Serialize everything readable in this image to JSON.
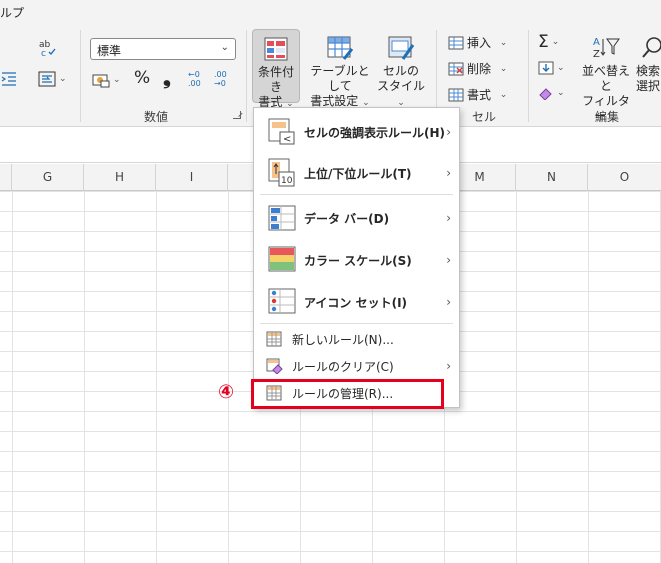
{
  "menubar": {
    "help_tab": "ルプ"
  },
  "ribbon": {
    "number_group": {
      "format_value": "標準",
      "label": "数値",
      "percent_label": "%",
      "comma_label": "❟",
      "increase_decimal": "←0 .00",
      "decrease_decimal": ".00 →0"
    },
    "styles_group": {
      "cond_format_label": "条件付き\n書式",
      "cond_format_line1": "条件付き",
      "cond_format_line2": "書式",
      "table_format_line1": "テーブルとして",
      "table_format_line2": "書式設定",
      "cell_styles_line1": "セルの",
      "cell_styles_line2": "スタイル"
    },
    "cells_group": {
      "insert_label": "挿入",
      "delete_label": "削除",
      "format_label": "書式",
      "label": "セル"
    },
    "editing_group": {
      "sort_filter_line1": "並べ替えと",
      "sort_filter_line2": "フィルター",
      "find_line1": "検索",
      "find_line2": "選択",
      "label": "編集"
    }
  },
  "columns": [
    "G",
    "H",
    "I",
    "M",
    "N",
    "O"
  ],
  "menu": {
    "items": [
      {
        "label": "セルの強調表示ルール(H)",
        "has_submenu": true
      },
      {
        "label": "上位/下位ルール(T)",
        "has_submenu": true
      },
      {
        "label": "データ バー(D)",
        "has_submenu": true
      },
      {
        "label": "カラー スケール(S)",
        "has_submenu": true
      },
      {
        "label": "アイコン セット(I)",
        "has_submenu": true
      },
      {
        "label": "新しいルール(N)...",
        "has_submenu": false
      },
      {
        "label": "ルールのクリア(C)",
        "has_submenu": true
      },
      {
        "label": "ルールの管理(R)...",
        "has_submenu": false
      }
    ],
    "submenu_arrow": "›"
  },
  "annotation": {
    "step": "④",
    "color": "#e6001e"
  },
  "icon_names": [
    "spell-check-icon",
    "indent-icon",
    "wrap-icon",
    "currency-icon",
    "conditional-format-icon",
    "format-table-icon",
    "cell-styles-icon",
    "insert-icon",
    "delete-icon",
    "format-icon",
    "sum-icon",
    "fill-icon",
    "clear-icon",
    "sort-filter-icon",
    "find-icon"
  ]
}
